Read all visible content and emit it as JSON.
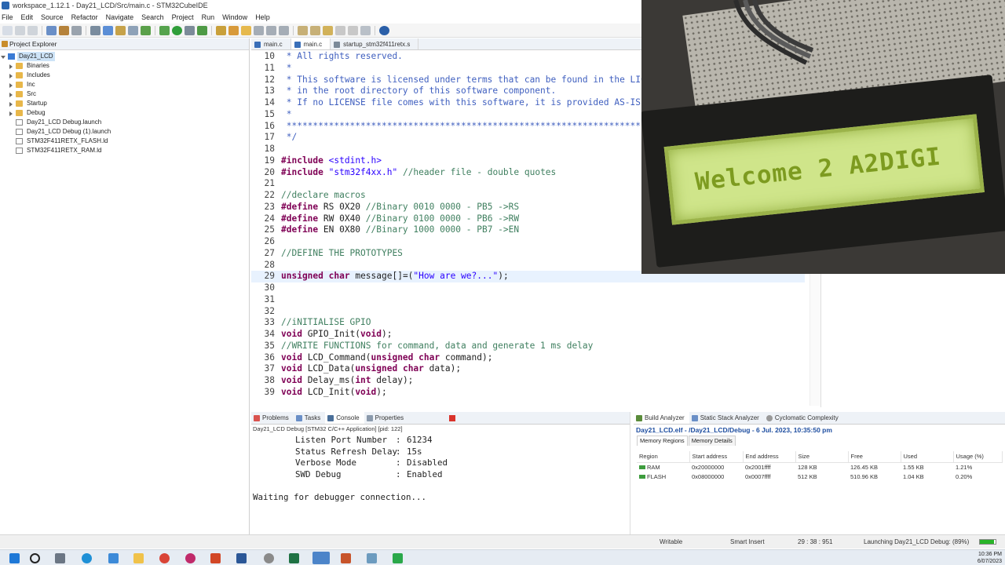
{
  "window": {
    "title": "workspace_1.12.1 - Day21_LCD/Src/main.c - STM32CubeIDE"
  },
  "menu": [
    "File",
    "Edit",
    "Source",
    "Refactor",
    "Navigate",
    "Search",
    "Project",
    "Run",
    "Window",
    "Help"
  ],
  "explorer": {
    "tab_label": "Project Explorer",
    "items": [
      {
        "label": "Day21_LCD",
        "kind": "project"
      },
      {
        "label": "Binaries",
        "kind": "folder"
      },
      {
        "label": "Includes",
        "kind": "folder"
      },
      {
        "label": "Inc",
        "kind": "folder"
      },
      {
        "label": "Src",
        "kind": "folder"
      },
      {
        "label": "Startup",
        "kind": "folder"
      },
      {
        "label": "Debug",
        "kind": "folder"
      },
      {
        "label": "Day21_LCD Debug.launch",
        "kind": "file"
      },
      {
        "label": "Day21_LCD Debug (1).launch",
        "kind": "file"
      },
      {
        "label": "STM32F411RETX_FLASH.ld",
        "kind": "file"
      },
      {
        "label": "STM32F411RETX_RAM.ld",
        "kind": "file"
      }
    ]
  },
  "editor": {
    "tabs": [
      "main.c",
      "main.c",
      "startup_stm32f411retx.s"
    ],
    "lines": [
      {
        "n": "10",
        "text": " * All rights reserved."
      },
      {
        "n": "11",
        "text": " *"
      },
      {
        "n": "12",
        "text": " * This software is licensed under terms that can be found in the LICENSE file"
      },
      {
        "n": "13",
        "text": " * in the root directory of this software component."
      },
      {
        "n": "14",
        "text": " * If no LICENSE file comes with this software, it is provided AS-IS."
      },
      {
        "n": "15",
        "text": " *"
      },
      {
        "n": "16",
        "text": " ******************************************************************************"
      },
      {
        "n": "17",
        "text": " */"
      },
      {
        "n": "18",
        "text": ""
      },
      {
        "n": "19",
        "text": "#include <stdint.h>"
      },
      {
        "n": "20",
        "text": "#include \"stm32f4xx.h\" //header file - double quotes"
      },
      {
        "n": "21",
        "text": ""
      },
      {
        "n": "22",
        "text": "//declare macros"
      },
      {
        "n": "23",
        "text": "#define RS 0X20 //Binary 0010 0000 - PB5 ->RS"
      },
      {
        "n": "24",
        "text": "#define RW 0X40 //Binary 0100 0000 - PB6 ->RW"
      },
      {
        "n": "25",
        "text": "#define EN 0X80 //Binary 1000 0000 - PB7 ->EN"
      },
      {
        "n": "26",
        "text": ""
      },
      {
        "n": "27",
        "text": "//DEFINE THE PROTOTYPES"
      },
      {
        "n": "28",
        "text": ""
      },
      {
        "n": "29",
        "text": "unsigned char message[]=(\"How are we?...\");"
      },
      {
        "n": "30",
        "text": ""
      },
      {
        "n": "31",
        "text": ""
      },
      {
        "n": "32",
        "text": ""
      },
      {
        "n": "33",
        "text": "//iNITIALISE GPIO"
      },
      {
        "n": "34",
        "text": "void GPIO_Init(void);"
      },
      {
        "n": "35",
        "text": "//WRITE FUNCTIONS for command, data and generate 1 ms delay"
      },
      {
        "n": "36",
        "text": "void LCD_Command(unsigned char command);"
      },
      {
        "n": "37",
        "text": "void LCD_Data(unsigned char data);"
      },
      {
        "n": "38",
        "text": "void Delay_ms(int delay);"
      },
      {
        "n": "39",
        "text": "void LCD_Init(void);"
      }
    ]
  },
  "console": {
    "tabs": [
      "Problems",
      "Tasks",
      "Console",
      "Properties"
    ],
    "subtitle": "Day21_LCD Debug [STM32 C/C++ Application] [pid: 122]",
    "rows": [
      {
        "key": "Listen Port Number",
        "value": "61234"
      },
      {
        "key": "Status Refresh Delay",
        "value": "15s"
      },
      {
        "key": "Verbose Mode",
        "value": "Disabled"
      },
      {
        "key": "SWD Debug",
        "value": "Enabled"
      }
    ],
    "message": "Waiting for debugger connection..."
  },
  "analyzer": {
    "tabs": [
      "Build Analyzer",
      "Static Stack Analyzer",
      "Cyclomatic Complexity"
    ],
    "title": "Day21_LCD.elf - /Day21_LCD/Debug - 6 Jul. 2023, 10:35:50 pm",
    "subtabs": [
      "Memory Regions",
      "Memory Details"
    ],
    "columns": [
      "Region",
      "Start address",
      "End address",
      "Size",
      "Free",
      "Used",
      "Usage (%)"
    ],
    "rows": [
      {
        "region": "RAM",
        "start": "0x20000000",
        "end": "0x2001ffff",
        "size": "128 KB",
        "free": "126.45 KB",
        "used": "1.55 KB",
        "usage": "1.21%"
      },
      {
        "region": "FLASH",
        "start": "0x08000000",
        "end": "0x0007ffff",
        "size": "512 KB",
        "free": "510.96 KB",
        "used": "1.04 KB",
        "usage": "0.20%"
      }
    ]
  },
  "status": {
    "writable": "Writable",
    "insert": "Smart Insert",
    "position": "29 : 38 : 951",
    "launch": "Launching Day21_LCD Debug: (89%)",
    "progress": 0.89
  },
  "taskbar": {
    "time": "10:36 PM",
    "date": "6/07/2023"
  },
  "webcam": {
    "lcd_text": "Welcome 2 A2DIGI"
  }
}
